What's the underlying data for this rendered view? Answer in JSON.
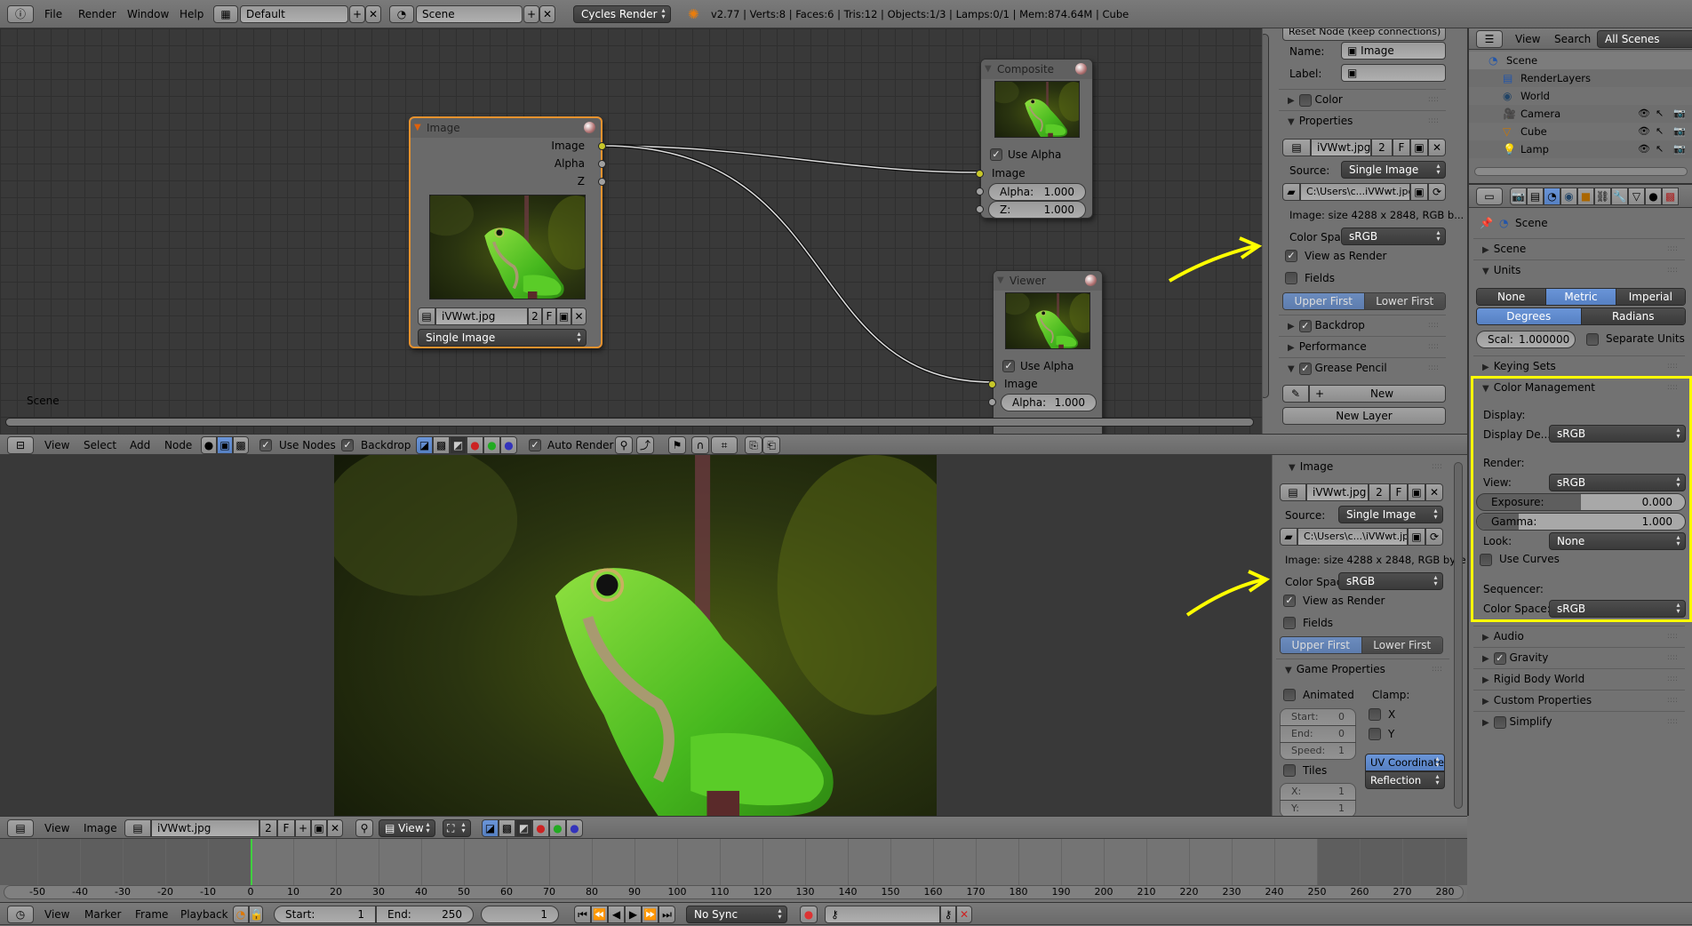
{
  "topbar": {
    "menus": [
      "File",
      "Render",
      "Window",
      "Help"
    ],
    "layout": "Default",
    "scene": "Scene",
    "engine": "Cycles Render",
    "stats": "v2.77 | Verts:8 | Faces:6 | Tris:12 | Objects:1/3 | Lamps:0/1 | Mem:874.64M | Cube"
  },
  "node_editor": {
    "scene_label": "Scene",
    "image_node": {
      "title": "Image",
      "outputs": [
        "Image",
        "Alpha",
        "Z"
      ],
      "image": "iVWwt.jpg",
      "users": "2",
      "fake": "F",
      "source": "Single Image"
    },
    "composite_node": {
      "title": "Composite",
      "use_alpha": "Use Alpha",
      "input": "Image",
      "alpha_label": "Alpha:",
      "alpha": "1.000",
      "z_label": "Z:",
      "z": "1.000"
    },
    "viewer_node": {
      "title": "Viewer",
      "use_alpha": "Use Alpha",
      "input": "Image",
      "alpha_label": "Alpha:",
      "alpha": "1.000"
    },
    "header": {
      "menus": [
        "View",
        "Select",
        "Add",
        "Node"
      ],
      "use_nodes": "Use Nodes",
      "backdrop": "Backdrop",
      "auto_render": "Auto Render"
    }
  },
  "node_panel": {
    "reset_node": "Reset Node (keep connections)",
    "name_label": "Name:",
    "name": "Image",
    "label_label": "Label:",
    "color": "Color",
    "properties": "Properties",
    "image": "iVWwt.jpg",
    "users": "2",
    "fake": "F",
    "source_label": "Source:",
    "source": "Single Image",
    "path": "C:\\Users\\c...iVWwt.jpg",
    "info": "Image: size 4288 x 2848, RGB b...",
    "colorspace_label": "Color Spa",
    "colorspace": "sRGB",
    "view_as_render": "View as Render",
    "fields": "Fields",
    "upper_first": "Upper First",
    "lower_first": "Lower First",
    "backdrop": "Backdrop",
    "performance": "Performance",
    "grease_pencil": "Grease Pencil",
    "new": "New",
    "new_layer": "New Layer"
  },
  "outliner": {
    "menus": [
      "View",
      "Search"
    ],
    "filter": "All Scenes",
    "items": [
      {
        "label": "Scene",
        "indent": 0
      },
      {
        "label": "RenderLayers",
        "indent": 1
      },
      {
        "label": "World",
        "indent": 1
      },
      {
        "label": "Camera",
        "indent": 1
      },
      {
        "label": "Cube",
        "indent": 1
      },
      {
        "label": "Lamp",
        "indent": 1
      }
    ]
  },
  "properties": {
    "context": "Scene",
    "scene": "Scene",
    "units": "Units",
    "unit_systems": [
      "None",
      "Metric",
      "Imperial"
    ],
    "unit_system_selected": "Metric",
    "rotation": [
      "Degrees",
      "Radians"
    ],
    "rotation_selected": "Degrees",
    "scale_label": "Scal:",
    "scale": "1.000000",
    "separate_units": "Separate Units",
    "keying_sets": "Keying Sets",
    "color_management": "Color Management",
    "display_heading": "Display:",
    "display_device_label": "Display De...",
    "display_device": "sRGB",
    "render_heading": "Render:",
    "view_label": "View:",
    "view": "sRGB",
    "exposure_label": "Exposure:",
    "exposure": "0.000",
    "exposure_fill": 0.5,
    "gamma_label": "Gamma:",
    "gamma": "1.000",
    "gamma_fill": 0.2,
    "look_label": "Look:",
    "look": "None",
    "use_curves": "Use Curves",
    "sequencer_heading": "Sequencer:",
    "seq_colorspace_label": "Color Space:",
    "seq_colorspace": "sRGB",
    "audio": "Audio",
    "gravity": "Gravity",
    "rigid_body_world": "Rigid Body World",
    "custom_properties": "Custom Properties",
    "simplify": "Simplify",
    "highlight_color": "#ffff00"
  },
  "image_panel": {
    "image_heading": "Image",
    "image": "iVWwt.jpg",
    "users": "2",
    "fake": "F",
    "source_label": "Source:",
    "source": "Single Image",
    "path": "C:\\Users\\c...\\iVWwt.jpg",
    "info": "Image: size 4288 x 2848, RGB byte",
    "colorspace_label": "Color Spac",
    "colorspace": "sRGB",
    "view_as_render": "View as Render",
    "fields": "Fields",
    "upper_first": "Upper First",
    "lower_first": "Lower First",
    "game_properties": "Game Properties",
    "animated": "Animated",
    "clamp": "Clamp:",
    "clamp_x": "X",
    "clamp_y": "Y",
    "start_label": "Start:",
    "start": "0",
    "end_label": "End:",
    "end": "0",
    "speed_label": "Speed:",
    "speed": "1",
    "tiles": "Tiles",
    "x_label": "X:",
    "x": "1",
    "y_label": "Y:",
    "y": "1",
    "uv_coordinates": "UV Coordinates",
    "reflection": "Reflection"
  },
  "image_editor_header": {
    "menus": [
      "View",
      "Image"
    ],
    "image": "iVWwt.jpg",
    "users": "2",
    "fake": "F",
    "view": "View"
  },
  "timeline": {
    "ticks": [
      -50,
      -40,
      -30,
      -20,
      -10,
      0,
      10,
      20,
      30,
      40,
      50,
      60,
      70,
      80,
      90,
      100,
      110,
      120,
      130,
      140,
      150,
      160,
      170,
      180,
      190,
      200,
      210,
      220,
      230,
      240,
      250,
      260,
      270,
      280
    ],
    "current_frame": 1,
    "menus": [
      "View",
      "Marker",
      "Frame",
      "Playback"
    ],
    "start_label": "Start:",
    "start": "1",
    "end_label": "End:",
    "end": "250",
    "frame": "1",
    "sync": "No Sync"
  }
}
